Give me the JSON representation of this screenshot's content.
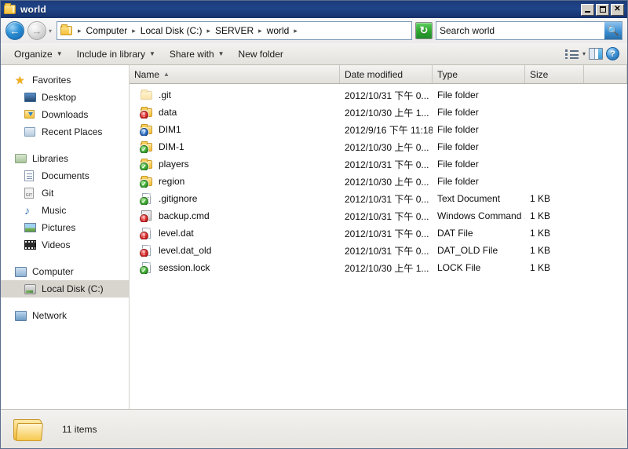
{
  "window": {
    "title": "world",
    "title_icon": "folder-icon",
    "controls": {
      "minimize": "minimize-button",
      "maximize": "maximize-button",
      "close": "close-button"
    }
  },
  "address_bar": {
    "back_label": "←",
    "forward_label": "→",
    "history_caret": "▾",
    "folder_icon": "folder-icon",
    "breadcrumb_separator": "▸",
    "crumbs": [
      "Computer",
      "Local Disk (C:)",
      "SERVER",
      "world"
    ],
    "refresh_label": "↻",
    "refresh_icon": "refresh-icon"
  },
  "search": {
    "value": "Search world",
    "placeholder": "Search world",
    "icon": "search-icon"
  },
  "toolbar": {
    "items": [
      {
        "label": "Organize",
        "has_caret": true
      },
      {
        "label": "Include in library",
        "has_caret": true
      },
      {
        "label": "Share with",
        "has_caret": true
      },
      {
        "label": "New folder",
        "has_caret": false
      }
    ],
    "view_icon": "view-list-icon",
    "view_caret": "▾",
    "preview_pane_icon": "preview-pane-icon",
    "help_label": "?",
    "help_icon": "help-icon"
  },
  "navigation_pane": {
    "groups": [
      {
        "header": {
          "label": "Favorites",
          "icon": "star-icon"
        },
        "items": [
          {
            "label": "Desktop",
            "icon": "desktop-icon"
          },
          {
            "label": "Downloads",
            "icon": "downloads-icon"
          },
          {
            "label": "Recent Places",
            "icon": "recent-places-icon"
          }
        ]
      },
      {
        "header": {
          "label": "Libraries",
          "icon": "libraries-icon"
        },
        "items": [
          {
            "label": "Documents",
            "icon": "documents-icon"
          },
          {
            "label": "Git",
            "icon": "git-library-icon"
          },
          {
            "label": "Music",
            "icon": "music-icon"
          },
          {
            "label": "Pictures",
            "icon": "pictures-icon"
          },
          {
            "label": "Videos",
            "icon": "videos-icon"
          }
        ]
      },
      {
        "header": {
          "label": "Computer",
          "icon": "computer-icon"
        },
        "items": [
          {
            "label": "Local Disk (C:)",
            "icon": "hard-disk-icon",
            "selected": true
          }
        ]
      },
      {
        "header": {
          "label": "Network",
          "icon": "network-icon"
        },
        "items": []
      }
    ]
  },
  "file_list": {
    "columns": [
      {
        "label": "Name",
        "sorted": true,
        "sort_mark": "▲"
      },
      {
        "label": "Date modified",
        "sorted": false,
        "sort_mark": ""
      },
      {
        "label": "Type",
        "sorted": false,
        "sort_mark": ""
      },
      {
        "label": "Size",
        "sorted": false,
        "sort_mark": ""
      }
    ],
    "rows": [
      {
        "name": ".git",
        "date": "2012/10/31 下午 0...",
        "type": "File folder",
        "size": "",
        "icon": "folder-icon",
        "badge": "",
        "ghost": true
      },
      {
        "name": "data",
        "date": "2012/10/30 上午 1...",
        "type": "File folder",
        "size": "",
        "icon": "folder-icon",
        "badge": "modified",
        "ghost": false
      },
      {
        "name": "DIM1",
        "date": "2012/9/16 下午 11:18",
        "type": "File folder",
        "size": "",
        "icon": "folder-icon",
        "badge": "unknown",
        "ghost": false
      },
      {
        "name": "DIM-1",
        "date": "2012/10/30 上午 0...",
        "type": "File folder",
        "size": "",
        "icon": "folder-icon",
        "badge": "ok",
        "ghost": false
      },
      {
        "name": "players",
        "date": "2012/10/31 下午 0...",
        "type": "File folder",
        "size": "",
        "icon": "folder-icon",
        "badge": "ok",
        "ghost": false
      },
      {
        "name": "region",
        "date": "2012/10/30 上午 0...",
        "type": "File folder",
        "size": "",
        "icon": "folder-icon",
        "badge": "ok",
        "ghost": false
      },
      {
        "name": ".gitignore",
        "date": "2012/10/31 下午 0...",
        "type": "Text Document",
        "size": "1 KB",
        "icon": "text-file-icon",
        "badge": "ok",
        "ghost": false
      },
      {
        "name": "backup.cmd",
        "date": "2012/10/31 下午 0...",
        "type": "Windows Command ...",
        "size": "1 KB",
        "icon": "command-file-icon",
        "badge": "modified",
        "ghost": false
      },
      {
        "name": "level.dat",
        "date": "2012/10/31 下午 0...",
        "type": "DAT File",
        "size": "1 KB",
        "icon": "generic-file-icon",
        "badge": "modified",
        "ghost": false
      },
      {
        "name": "level.dat_old",
        "date": "2012/10/31 下午 0...",
        "type": "DAT_OLD File",
        "size": "1 KB",
        "icon": "generic-file-icon",
        "badge": "modified",
        "ghost": false
      },
      {
        "name": "session.lock",
        "date": "2012/10/30 上午 1...",
        "type": "LOCK File",
        "size": "1 KB",
        "icon": "generic-file-icon",
        "badge": "ok",
        "ghost": false
      }
    ]
  },
  "status_bar": {
    "item_count": "11 items",
    "folder_icon": "large-folder-icon"
  },
  "colors": {
    "title_bar": "#1f4488",
    "selection": "#d8d4ce",
    "badge_ok": "#3ea832",
    "badge_modified": "#d62b2b",
    "badge_unknown": "#2c6fc4",
    "refresh_green": "#2faa2f"
  }
}
